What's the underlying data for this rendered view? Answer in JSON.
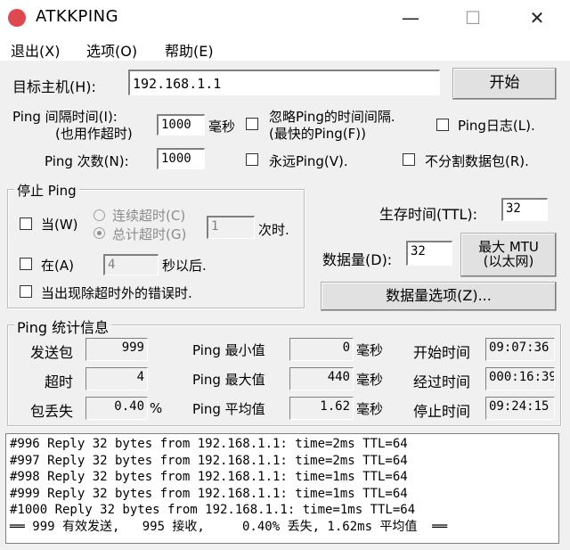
{
  "window": {
    "title": "ATKKPING",
    "minimize_glyph": "—",
    "maximize_glyph": "☐",
    "close_glyph": "✕"
  },
  "menu": [
    "退出(X)",
    "选项(O)",
    "帮助(E)"
  ],
  "target": {
    "label": "目标主机(H):",
    "value": "192.168.1.1",
    "start_button": "开始"
  },
  "interval": {
    "label_line1": "Ping 间隔时间(I):",
    "label_line2": "(也用作超时)",
    "value": "1000",
    "unit": "毫秒"
  },
  "ignore_time": {
    "label_line1": "忽略Ping的时间间隔.",
    "label_line2": "(最快的Ping(F))",
    "checked": false
  },
  "ping_log": {
    "label": "Ping日志(L).",
    "checked": false
  },
  "count": {
    "label": "Ping 次数(N):",
    "value": "1000"
  },
  "forever": {
    "label": "永远Ping(V).",
    "checked": false
  },
  "no_fragment": {
    "label": "不分割数据包(R).",
    "checked": false
  },
  "stop_group": {
    "title": "停止 Ping",
    "when_label": "当(W)",
    "consecutive_label": "连续超时(C)",
    "total_label": "总计超时(G)",
    "timeout_value": "1",
    "times_suffix": "次时.",
    "after_label": "在(A)",
    "after_value": "4",
    "after_suffix": "秒以后.",
    "error_label": "当出现除超时外的错误时."
  },
  "ttl": {
    "label": "生存时间(TTL):",
    "value": "32"
  },
  "data_size": {
    "label": "数据量(D):",
    "value": "32",
    "mtu_button_line1": "最大 MTU",
    "mtu_button_line2": "(以太网)",
    "options_button": "数据量选项(Z)..."
  },
  "stats": {
    "title": "Ping  统计信息",
    "sent_label": "发送包",
    "sent": "999",
    "timeout_label": "超时",
    "timeout": "4",
    "loss_label": "包丢失",
    "loss": "0.40",
    "loss_unit": "%",
    "min_label": "Ping 最小值",
    "min": "0",
    "min_unit": "毫秒",
    "max_label": "Ping 最大值",
    "max": "440",
    "max_unit": "毫秒",
    "avg_label": "Ping 平均值",
    "avg": "1.62",
    "avg_unit": "毫秒",
    "start_label": "开始时间",
    "start_time": "09:07:36",
    "elapsed_label": "经过时间",
    "elapsed_time": "000:16:39",
    "stop_label": "停止时间",
    "stop_time": "09:24:15"
  },
  "log_lines": [
    "#996 Reply 32 bytes from 192.168.1.1: time=2ms TTL=64",
    "#997 Reply 32 bytes from 192.168.1.1: time=2ms TTL=64",
    "#998 Reply 32 bytes from 192.168.1.1: time=1ms TTL=64",
    "#999 Reply 32 bytes from 192.168.1.1: time=1ms TTL=64",
    "#1000 Reply 32 bytes from 192.168.1.1: time=1ms TTL=64",
    "══ 999 有效发送,   995 接收,     0.40% 丢失, 1.62ms 平均值  ══"
  ],
  "colors": {
    "app_icon": "#e0484f",
    "window_bg": "#f0f0f0",
    "field_bg": "#ffffff"
  }
}
